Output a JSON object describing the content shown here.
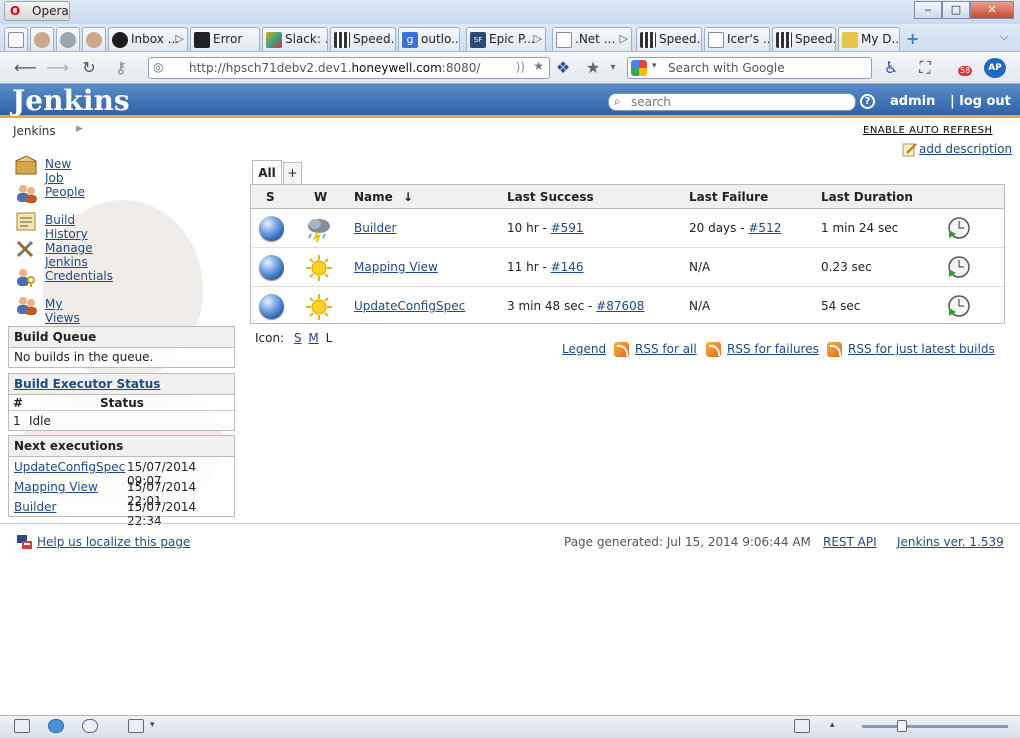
{
  "browser": {
    "app_name": "Opera",
    "tabs": [
      {
        "label": "",
        "icon": "blank-page-icon"
      },
      {
        "label": "",
        "icon": "jenkins-icon"
      },
      {
        "label": "",
        "icon": "fox-icon"
      },
      {
        "label": "",
        "icon": "jenkins-icon"
      },
      {
        "label": "Inbox ...",
        "icon": "mail-icon"
      },
      {
        "label": "Error",
        "icon": "error-icon"
      },
      {
        "label": "Slack: ...",
        "icon": "slack-icon"
      },
      {
        "label": "Speed...",
        "icon": "grid-icon"
      },
      {
        "label": "outlo...",
        "icon": "google-icon"
      },
      {
        "label": "Epic P...",
        "icon": "sf-icon"
      },
      {
        "label": ".Net ...",
        "icon": "page-icon"
      },
      {
        "label": "Speed...",
        "icon": "grid-icon"
      },
      {
        "label": "Icer's ...",
        "icon": "page-icon"
      },
      {
        "label": "Speed...",
        "icon": "grid-icon"
      },
      {
        "label": "My D...",
        "icon": "folder-icon"
      }
    ],
    "url_prefix": "http://hpsch71debv2.dev1.",
    "url_domain": "honeywell.com",
    "url_suffix": ":8080/",
    "search_placeholder": "Search with Google",
    "notification_count": "58"
  },
  "jenkins": {
    "logo": "Jenkins",
    "search_placeholder": "search",
    "help": "?",
    "user": "admin",
    "logout": "| log out",
    "breadcrumb": "Jenkins",
    "auto_refresh": "ENABLE AUTO REFRESH",
    "add_description": "add description",
    "tasks": [
      {
        "label": "New Job",
        "icon": "new-job-icon"
      },
      {
        "label": "People",
        "icon": "people-icon"
      },
      {
        "label": "Build History",
        "icon": "build-history-icon"
      },
      {
        "label": "Manage Jenkins",
        "icon": "manage-jenkins-icon"
      },
      {
        "label": "Credentials",
        "icon": "credentials-icon"
      },
      {
        "label": "My Views",
        "icon": "my-views-icon"
      }
    ],
    "build_queue": {
      "title": "Build Queue",
      "empty": "No builds in the queue."
    },
    "executors": {
      "title": "Build Executor Status",
      "col_num": "#",
      "col_status": "Status",
      "rows": [
        {
          "num": "1",
          "status": "Idle"
        }
      ]
    },
    "next_executions": {
      "title": "Next executions",
      "rows": [
        {
          "job": "UpdateConfigSpec",
          "time": "15/07/2014 09:07"
        },
        {
          "job": "Mapping View",
          "time": "15/07/2014 22:01"
        },
        {
          "job": "Builder",
          "time": "15/07/2014 22:34"
        }
      ]
    },
    "views": {
      "active": "All",
      "add": "+"
    },
    "table": {
      "headers": {
        "s": "S",
        "w": "W",
        "name": "Name",
        "sort": "↓",
        "last_success": "Last Success",
        "last_failure": "Last Failure",
        "last_duration": "Last Duration"
      },
      "jobs": [
        {
          "name": "Builder",
          "weather": "stormy",
          "success_age": "10 hr - ",
          "success_build": "#591",
          "failure_age": "20 days - ",
          "failure_build": "#512",
          "duration": "1 min 24 sec"
        },
        {
          "name": "Mapping View",
          "weather": "sunny",
          "success_age": "11 hr - ",
          "success_build": "#146",
          "failure_age": "N/A",
          "failure_build": "",
          "duration": "0.23 sec"
        },
        {
          "name": "UpdateConfigSpec",
          "weather": "sunny",
          "success_age": "3 min 48 sec - ",
          "success_build": "#87608",
          "failure_age": "N/A",
          "failure_build": "",
          "duration": "54 sec"
        }
      ]
    },
    "icon_size": {
      "label": "Icon:",
      "s": "S",
      "m": "M",
      "l": "L"
    },
    "legend": "Legend",
    "rss": {
      "all": "RSS for all",
      "failures": "RSS for failures",
      "latest": "RSS for just latest builds"
    },
    "footer": {
      "localize": "Help us localize this page",
      "generated": "Page generated: Jul 15, 2014 9:06:44 AM",
      "rest_api": "REST API",
      "version": "Jenkins ver. 1.539"
    }
  },
  "colors": {
    "header_blue": "#2f63a8",
    "header_accent": "#f0a23b",
    "link": "#204a87"
  }
}
